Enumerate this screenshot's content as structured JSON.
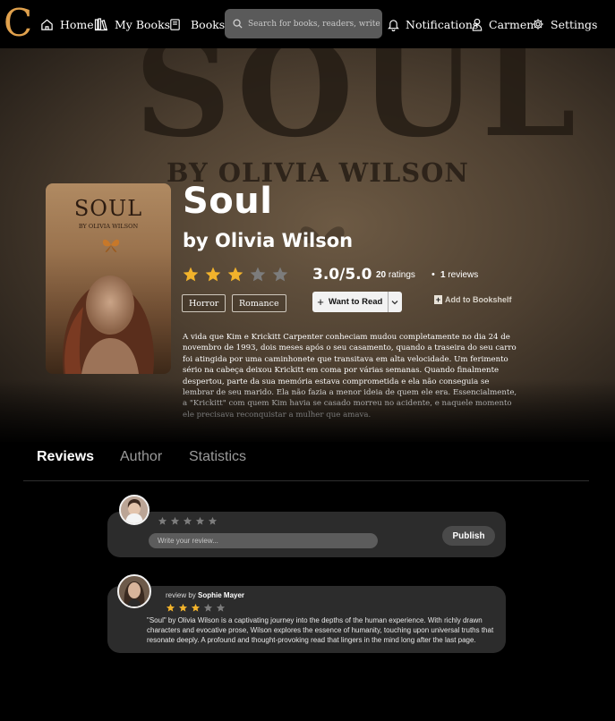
{
  "nav": {
    "logo": "C",
    "home": "Home",
    "my_books": "My Books",
    "books": "Books",
    "search_placeholder": "Search for books, readers, writers ...",
    "notifications": "Notifications",
    "user": "Carmen",
    "settings": "Settings"
  },
  "book": {
    "bg_title": "SOUL",
    "bg_author": "BY OLIVIA WILSON",
    "cover_title": "SOUL",
    "cover_author": "BY OLIVIA WILSON",
    "title": "Soul",
    "author": "by Olivia Wilson",
    "rating_value": 3,
    "rating_max": 5,
    "rating_text": "3.0/5.0",
    "ratings_count": "20",
    "ratings_label": "ratings",
    "reviews_count": "1",
    "reviews_label": "reviews",
    "tags": [
      "Horror",
      "Romance"
    ],
    "want_to_read": "Want to Read",
    "add_to_bookshelf": "Add to Bookshelf",
    "description": "A  vida que Kim e Krickitt Carpenter conheciam mudou completamente no dia  24 de novembro de 1993, dois meses após o seu casamento, quando a  traseira do seu carro foi atingida por uma caminhonete que transitava em alta velocidade. Um ferimento sério na cabeça deixou Krickitt em coma  por várias semanas. Quando finalmente despertou, parte da sua memória  estava comprometida e ela não conseguia se lembrar de seu marido. Ela  não fazia a menor ideia de quem ele era. Essencialmente, a \"Krickitt\"  com quem Kim havia se casado morreu no acidente, e naquele momento ele precisava reconquistar a mulher que amava."
  },
  "tabs": [
    "Reviews",
    "Author",
    "Statistics"
  ],
  "active_tab": 0,
  "compose": {
    "placeholder": "Write your review...",
    "publish": "Publish",
    "rating_value": 0
  },
  "review": {
    "prefix": "review by",
    "reviewer": "Sophie Mayer",
    "rating_value": 3,
    "text": "\"Soul\" by Olivia Wilson is a captivating journey into the depths of the human experience. With richly drawn characters and evocative prose, Wilson explores the essence of humanity, touching upon universal truths that resonate deeply. A profound and thought-provoking read that lingers in the mind long after the last page."
  },
  "colors": {
    "accent": "#e0a14d",
    "star_on": "#f2b32b",
    "star_off": "#7c7c7c"
  }
}
